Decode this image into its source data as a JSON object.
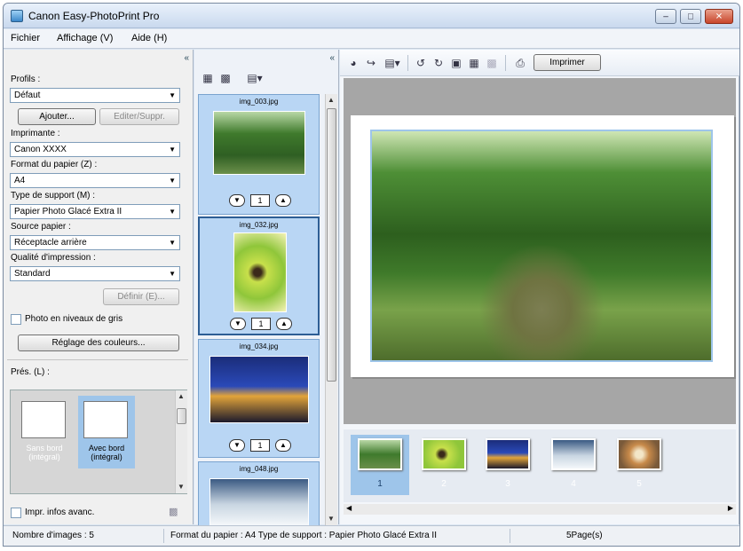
{
  "app": {
    "title": "Canon Easy-PhotoPrint Pro"
  },
  "menu": [
    "Fichier",
    "Affichage (V)",
    "Aide (H)"
  ],
  "settings": {
    "profiles_label": "Profils :",
    "profile_value": "Défaut",
    "add_button": "Ajouter...",
    "edit_button": "Editer/Suppr.",
    "printer_label": "Imprimante :",
    "printer_value": "Canon XXXX",
    "paper_size_label": "Format du papier (Z) :",
    "paper_size_value": "A4",
    "media_type_label": "Type de support (M) :",
    "media_type_value": "Papier Photo Glacé Extra II",
    "paper_source_label": "Source papier :",
    "paper_source_value": "Réceptacle arrière",
    "print_quality_label": "Qualité d'impression :",
    "print_quality_value": "Standard",
    "define_button": "Définir (E)...",
    "grayscale_label": "Photo en niveaux de gris",
    "color_adjust_button": "Réglage des couleurs...",
    "layout_label": "Prés. (L) :",
    "layouts": [
      {
        "label": "Sans bord (intégral)",
        "selected": false
      },
      {
        "label": "Avec bord (intégral)",
        "selected": true
      }
    ],
    "advanced_info_label": "Impr. infos avanc."
  },
  "thumbnails": [
    {
      "name": "img_003.jpg",
      "copies": "1",
      "selected": false
    },
    {
      "name": "img_032.jpg",
      "copies": "1",
      "selected": true
    },
    {
      "name": "img_034.jpg",
      "copies": "1",
      "selected": false
    },
    {
      "name": "img_048.jpg",
      "copies": "1",
      "selected": false
    }
  ],
  "toolbar": {
    "print_button": "Imprimer"
  },
  "pages": [
    {
      "number": "1",
      "selected": true
    },
    {
      "number": "2",
      "selected": false
    },
    {
      "number": "3",
      "selected": false
    },
    {
      "number": "4",
      "selected": false
    },
    {
      "number": "5",
      "selected": false
    }
  ],
  "status": {
    "image_count": "Nombre d'images : 5",
    "paper_info": "Format du papier : A4  Type de support : Papier Photo Glacé Extra II",
    "page_count": "5Page(s)"
  },
  "colors": {
    "selection": "#9ec5ea",
    "preview_bg": "#a6a6a6",
    "window_frame": "#dce6f2"
  }
}
